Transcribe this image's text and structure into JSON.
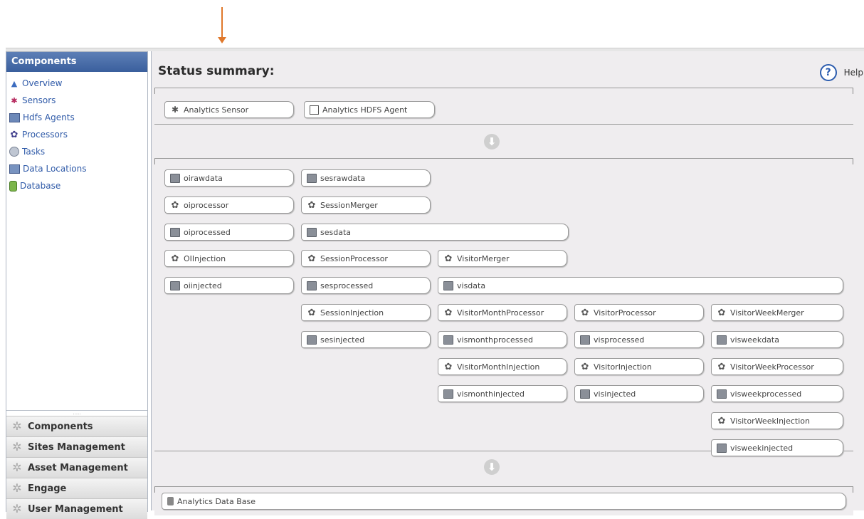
{
  "sidebar": {
    "header": "Components",
    "items": [
      {
        "label": "Overview"
      },
      {
        "label": "Sensors"
      },
      {
        "label": "Hdfs Agents"
      },
      {
        "label": "Processors"
      },
      {
        "label": "Tasks"
      },
      {
        "label": "Data Locations"
      },
      {
        "label": "Database"
      }
    ],
    "grip": ".....",
    "accordion": [
      {
        "label": "Components"
      },
      {
        "label": "Sites Management"
      },
      {
        "label": "Asset Management"
      },
      {
        "label": "Engage"
      },
      {
        "label": "User Management"
      }
    ]
  },
  "main": {
    "title": "Status summary:",
    "help_label": "Help",
    "help_symbol": "?",
    "sources": [
      {
        "label": "Analytics Sensor",
        "icon": "sensor-icon"
      },
      {
        "label": "Analytics HDFS Agent",
        "icon": "agent-icon"
      }
    ],
    "pipeline": [
      {
        "label": "oirawdata",
        "kind": "data"
      },
      {
        "label": "oiprocessor",
        "kind": "proc"
      },
      {
        "label": "oiprocessed",
        "kind": "data"
      },
      {
        "label": "OIInjection",
        "kind": "proc"
      },
      {
        "label": "oiinjected",
        "kind": "data"
      },
      {
        "label": "sesrawdata",
        "kind": "data"
      },
      {
        "label": "SessionMerger",
        "kind": "proc"
      },
      {
        "label": "sesdata",
        "kind": "data"
      },
      {
        "label": "SessionProcessor",
        "kind": "proc"
      },
      {
        "label": "sesprocessed",
        "kind": "data"
      },
      {
        "label": "SessionInjection",
        "kind": "proc"
      },
      {
        "label": "sesinjected",
        "kind": "data"
      },
      {
        "label": "VisitorMerger",
        "kind": "proc"
      },
      {
        "label": "visdata",
        "kind": "data"
      },
      {
        "label": "VisitorMonthProcessor",
        "kind": "proc"
      },
      {
        "label": "vismonthprocessed",
        "kind": "data"
      },
      {
        "label": "VisitorMonthInjection",
        "kind": "proc"
      },
      {
        "label": "vismonthinjected",
        "kind": "data"
      },
      {
        "label": "VisitorProcessor",
        "kind": "proc"
      },
      {
        "label": "visprocessed",
        "kind": "data"
      },
      {
        "label": "VisitorInjection",
        "kind": "proc"
      },
      {
        "label": "visinjected",
        "kind": "data"
      },
      {
        "label": "VisitorWeekMerger",
        "kind": "proc"
      },
      {
        "label": "visweekdata",
        "kind": "data"
      },
      {
        "label": "VisitorWeekProcessor",
        "kind": "proc"
      },
      {
        "label": "visweekprocessed",
        "kind": "data"
      },
      {
        "label": "VisitorWeekInjection",
        "kind": "proc"
      },
      {
        "label": "visweekinjected",
        "kind": "data"
      }
    ],
    "database": {
      "label": "Analytics Data Base"
    }
  }
}
